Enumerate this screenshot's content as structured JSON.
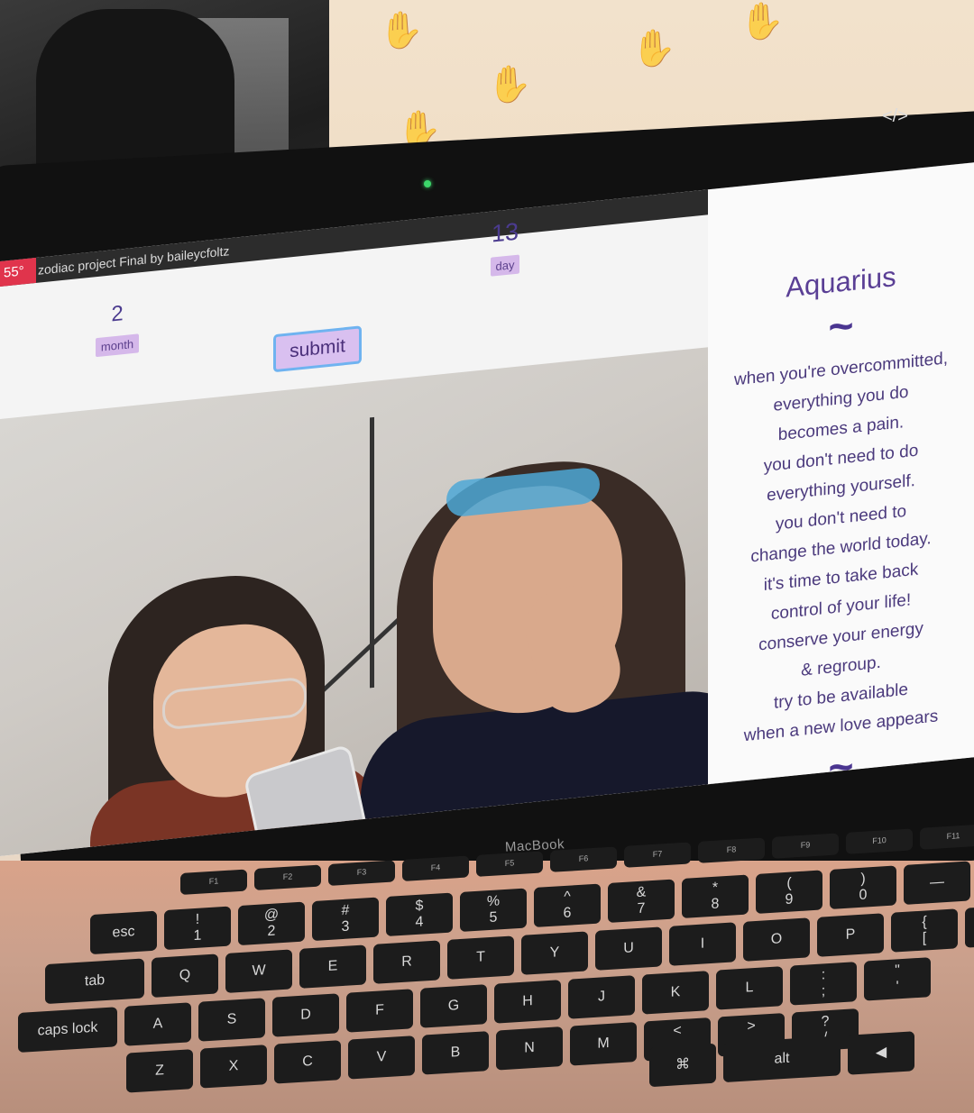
{
  "environment": {
    "laptop_brand": "MacBook",
    "camera_color": "#3cd66a"
  },
  "browser": {
    "status_temp": "55°",
    "window_title": "zodiac project Final by baileycfoltz",
    "code_icon": "</>"
  },
  "form": {
    "month_value": "2",
    "month_label": "month",
    "day_value": "13",
    "day_label": "day",
    "submit_label": "submit"
  },
  "horoscope": {
    "sign": "Aquarius",
    "divider_top": "~",
    "lines": [
      "when you're overcommitted,",
      "everything you do",
      "becomes a pain.",
      "you don't need to do",
      "everything yourself.",
      "you don't need to",
      "change the world today.",
      "it's time to take back",
      "control of your life!",
      "conserve your energy",
      "& regroup.",
      "try to be available",
      "when a new love appears"
    ],
    "divider_bottom": "~"
  },
  "colors": {
    "accent_purple": "#5a3f95",
    "tag_background": "#d5b8ea",
    "button_border": "#6fb3f0",
    "temp_badge": "#e0344c"
  },
  "keyboard": {
    "row_fn": [
      "F1",
      "F2",
      "F3",
      "F4",
      "F5",
      "F6",
      "F7",
      "F8",
      "F9",
      "F10",
      "F11",
      "F12"
    ],
    "row_num": [
      "esc",
      "!\n1",
      "@\n2",
      "#\n3",
      "$\n4",
      "%\n5",
      "^\n6",
      "&\n7",
      "*\n8",
      "(\n9",
      ")\n0",
      "—",
      "+\n="
    ],
    "row_q": [
      "tab",
      "Q",
      "W",
      "E",
      "R",
      "T",
      "Y",
      "U",
      "I",
      "O",
      "P",
      "{\n[",
      "}\n]"
    ],
    "row_a": [
      "caps lock",
      "A",
      "S",
      "D",
      "F",
      "G",
      "H",
      "J",
      "K",
      "L",
      ":\n;",
      "\"\n'"
    ],
    "row_z": [
      "Z",
      "X",
      "C",
      "V",
      "B",
      "N",
      "M",
      "<\n,",
      ">\n.",
      "?\n/"
    ],
    "row_bottom": [
      "⌘",
      "alt",
      "◀"
    ]
  }
}
